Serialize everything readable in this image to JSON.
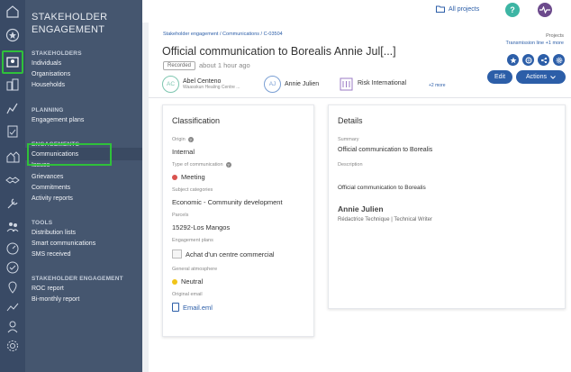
{
  "nav": {
    "title_line1": "STAKEHOLDER",
    "title_line2": "ENGAGEMENT",
    "sections": {
      "stakeholders": {
        "label": "STAKEHOLDERS",
        "items": [
          "Individuals",
          "Organisations",
          "Households"
        ]
      },
      "planning": {
        "label": "PLANNING",
        "items": [
          "Engagement plans"
        ]
      },
      "engagements": {
        "label": "ENGAGEMENTS",
        "items": [
          "Communications",
          "Issues",
          "Grievances",
          "Commitments",
          "Activity reports"
        ]
      },
      "tools": {
        "label": "TOOLS",
        "items": [
          "Distribution lists",
          "Smart communications",
          "SMS received"
        ]
      },
      "stakeholder_engagement": {
        "label": "STAKEHOLDER ENGAGEMENT",
        "items": [
          "ROC report",
          "Bi-monthly report"
        ]
      }
    }
  },
  "topbar": {
    "all_projects": "All projects",
    "help": "?"
  },
  "header": {
    "breadcrumb": "Stakeholder engagement  /  Communications  /  C-03504",
    "projects_label": "Projects",
    "projects_value": "Transmission line",
    "projects_more": "+1 more",
    "title": "Official communication to Borealis Annie Jul[...]",
    "status_badge": "Recorded",
    "time": "about 1 hour ago",
    "edit_label": "Edit",
    "actions_label": "Actions"
  },
  "people": [
    {
      "initials": "AC",
      "name": "Abel Centeno",
      "sub": "Waasskun Healing Centre ..."
    },
    {
      "initials": "AJ",
      "name": "Annie Julien",
      "sub": ""
    },
    {
      "initials": "",
      "name": "Risk International",
      "sub": ""
    }
  ],
  "people_more": "+2 more",
  "classification": {
    "title": "Classification",
    "origin_label": "Origin",
    "origin": "Internal",
    "type_label": "Type of communication",
    "type": "Meeting",
    "type_color": "#d9534f",
    "subject_label": "Subject categories",
    "subject": "Economic - Community development",
    "parcels_label": "Parcels",
    "parcels": "15292-Los Mangos",
    "plans_label": "Engagement plans",
    "plan": "Achat d'un centre commercial",
    "atmosphere_label": "General atmosphere",
    "atmosphere": "Neutral",
    "atmosphere_color": "#f0c419",
    "email_label": "Original email",
    "email": "Email.eml"
  },
  "details": {
    "title": "Details",
    "summary_label": "Summary",
    "summary": "Official communication to Borealis",
    "description_label": "Description",
    "description": "Official communication to Borealis",
    "author_name": "Annie Julien",
    "author_role": "Rédactrice Technique | Technical Writer"
  }
}
